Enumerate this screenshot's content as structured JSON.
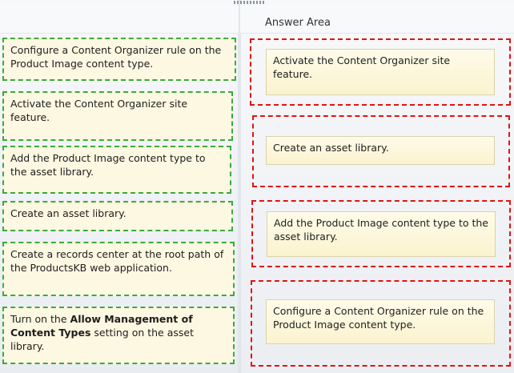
{
  "answer_area": {
    "title": "Answer Area"
  },
  "source_items": [
    {
      "text": "Configure a Content Organizer rule on the Product Image content type."
    },
    {
      "text": "Activate the Content Organizer site feature."
    },
    {
      "text": "Add the Product Image content type to the asset library."
    },
    {
      "text": "Create an asset library."
    },
    {
      "text": "Create a records center at the root path of the ProductsKB web application."
    },
    {
      "text_before": "Turn on the ",
      "text_bold": "Allow Management of Content Types",
      "text_after": " setting on the asset library."
    }
  ],
  "answer_items": [
    {
      "text": "Activate the Content Organizer site feature."
    },
    {
      "text": "Create an asset library."
    },
    {
      "text": "Add the Product Image content type to the asset library."
    },
    {
      "text": "Configure a Content Organizer rule on the Product Image content type."
    }
  ],
  "colors": {
    "source_border": "#3caa3c",
    "target_border": "#e01414",
    "card_fill": "#fdf8e2"
  }
}
